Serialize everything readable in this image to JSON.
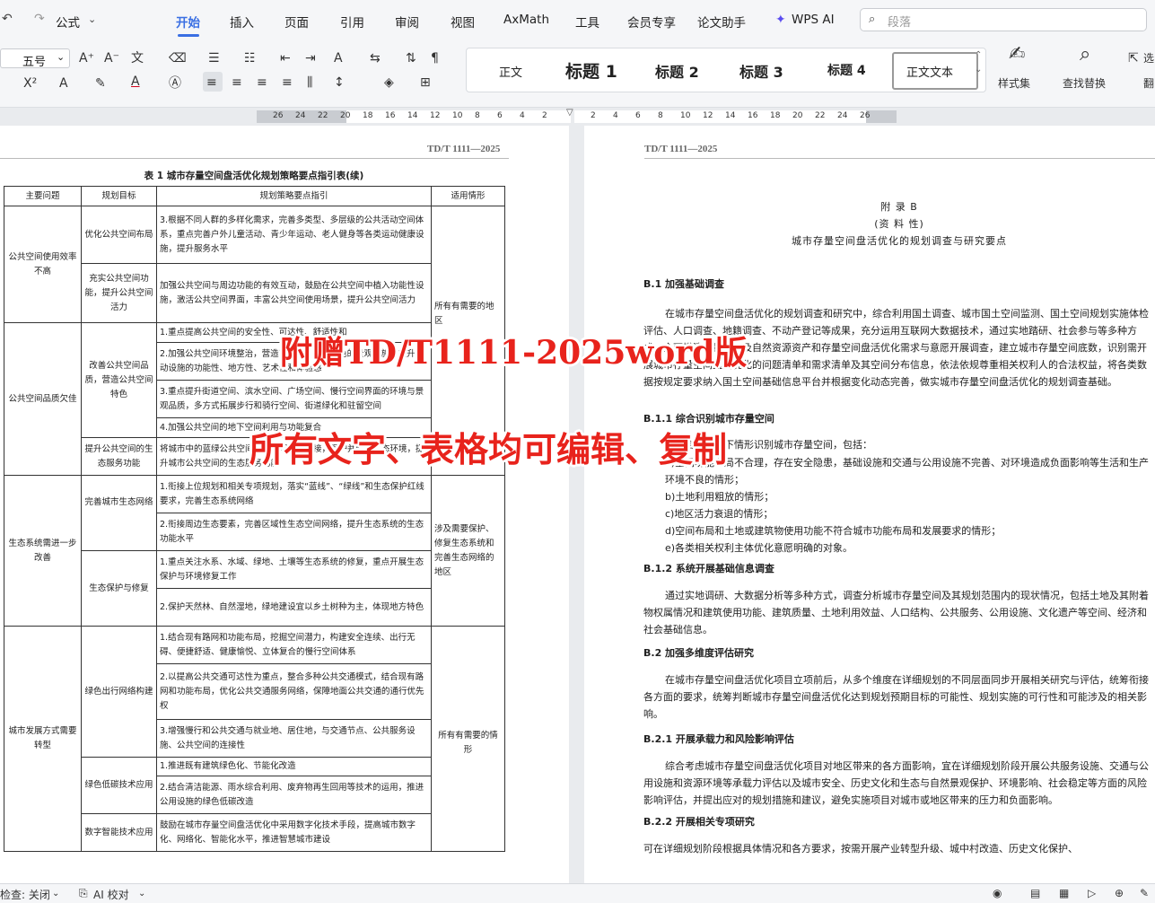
{
  "menubar": {
    "quick": "公式",
    "tabs": [
      "开始",
      "插入",
      "页面",
      "引用",
      "审阅",
      "视图",
      "AxMath",
      "工具",
      "会员专享",
      "论文助手",
      "WPS AI"
    ],
    "active_tab": "开始",
    "search_placeholder": "段落"
  },
  "ribbon": {
    "font_size": "五号",
    "styles": [
      "正文",
      "标题 1",
      "标题 2",
      "标题 3",
      "标题 4",
      "正文文本"
    ],
    "styles_set": "样式集",
    "find_replace": "查找替换",
    "select": "选",
    "other": "翻"
  },
  "ruler": {
    "left": [
      "26",
      "24",
      "22",
      "20",
      "18",
      "16",
      "14",
      "12",
      "10",
      "8",
      "6",
      "4",
      "2"
    ],
    "right": [
      "2",
      "4",
      "6",
      "8",
      "10",
      "12",
      "14",
      "16",
      "18",
      "20",
      "22",
      "24",
      "26"
    ]
  },
  "left_page": {
    "header": "TD/T 1111—2025",
    "caption": "表 1  城市存量空间盘活优化规划策略要点指引表(续)",
    "columns": [
      "主要问题",
      "规划目标",
      "规划策略要点指引",
      "适用情形"
    ],
    "rows": {
      "p1": "公共空间使用效率不高",
      "g1": "优化公共空间布局",
      "s1": "3.根据不同人群的多样化需求，完善多类型、多层级的公共活动空间体系，重点完善户外儿童活动、青少年运动、老人健身等各类运动健康设施，提升服务水平",
      "g2": "充实公共空间功能，提升公共空间活力",
      "s2": "加强公共空间与周边功能的有效互动，鼓励在公共空间中植入功能性设施，激活公共空间界面，丰富公共空间使用场景，提升公共空间活力",
      "a1": "所有有需要的地区",
      "p2": "公共空间品质欠佳",
      "g3": "改善公共空间品质，营造公共空间特色",
      "s3": "1.重点提高公共空间的安全性、可达性、舒适性和",
      "s4": "2.加强公共空间环境整治，营造高品质、具有特色的景观设施，提升活动设施的功能性、地方性、艺术性和体验感",
      "s5": "3.重点提升街道空间、滨水空间、广场空间、慢行空间界面的环境与景观品质，多方式拓展步行和骑行空间、街道绿化和驻留空间",
      "s6": "4.加强公共空间的地下空间利用与功能复合",
      "g4": "提升公共空间的生态服务功能",
      "s7": "将城市中的蓝绿公共空间与生态网络相连接，保护并修复生态环境，提升城市公共空间的生态服务功能",
      "p3": "生态系统需进一步改善",
      "g5": "完善城市生态网络",
      "s8": "1.衔接上位规划和相关专项规划，落实“蓝线”、“绿线”和生态保护红线要求，完善生态系统网络",
      "s9": "2.衔接周边生态要素，完善区域性生态空间网络，提升生态系统的生态功能水平",
      "a2": "涉及需要保护、修复生态系统和完善生态网络的地区",
      "g6": "生态保护与修复",
      "s10": "1.重点关注水系、水域、绿地、土壤等生态系统的修复，重点开展生态保护与环境修复工作",
      "s11": "2.保护天然林、自然湿地，绿地建设宜以乡土树种为主，体现地方特色",
      "p4": "城市发展方式需要转型",
      "g7": "绿色出行网络构建",
      "s12": "1.结合现有路网和功能布局，挖掘空间潜力，构建安全连续、出行无碍、便捷舒适、健康愉悦、立体复合的慢行空间体系",
      "s13": "2.以提高公共交通可达性为重点，整合多种公共交通模式，结合现有路网和功能布局，优化公共交通服务网络，保障地面公共交通的通行优先权",
      "s14": "3.增强慢行和公共交通与就业地、居住地，与交通节点、公共服务设施、公共空间的连接性",
      "a3": "所有有需要的情形",
      "g8": "绿色低碳技术应用",
      "s15": "1.推进既有建筑绿色化、节能化改造",
      "s16": "2.结合清洁能源、雨水综合利用、废弃物再生回用等技术的运用，推进公用设施的绿色低碳改造",
      "g9": "数字智能技术应用",
      "s17": "鼓励在城市存量空间盘活优化中采用数字化技术手段，提高城市数字化、网络化、智能化水平，推进智慧城市建设"
    }
  },
  "right_page": {
    "header": "TD/T 1111—2025",
    "appendix": "附    录    B",
    "nature": "(资 料 性)",
    "title": "城市存量空间盘活优化的规划调查与研究要点",
    "b1": "B.1  加强基础调查",
    "b1_text": "在城市存量空间盘活优化的规划调查和研究中，综合利用国土调查、城市国土空间监测、国土空间规划实施体检评估、人口调查、地籍调查、不动产登记等成果，充分运用互联网大数据技术，通过实地踏研、社会参与等多种方式，全面摸清存量空间及自然资源资产和存量空间盘活优化需求与意愿开展调查，建立城市存量空间底数，识别需开展城市存量空间盘活优化的问题清单和需求清单及其空间分布信息，依法依规尊重相关权利人的合法权益，将各类数据按规定要求纳入国土空间基础信息平台并根据变化动态完善，做实城市存量空间盘活优化的规划调查基础。",
    "b11": "B.1.1  综合识别城市存量空间",
    "b11_text": "宜综合考虑以下情形识别城市存量空间，包括：",
    "b11_items": [
      "a)空间功能布局不合理，存在安全隐患，基础设施和交通与公用设施不完善、对环境造成负面影响等生活和生产环境不良的情形；",
      "b)土地利用粗放的情形；",
      "c)地区活力衰退的情形；",
      "d)空间布局和土地或建筑物使用功能不符合城市功能布局和发展要求的情形；",
      "e)各类相关权利主体优化意愿明确的对象。"
    ],
    "b12": "B.1.2  系统开展基础信息调查",
    "b12_text": "通过实地调研、大数据分析等多种方式，调查分析城市存量空间及其规划范围内的现状情况，包括土地及其附着物权属情况和建筑使用功能、建筑质量、土地利用效益、人口结构、公共服务、公用设施、文化遗产等空间、经济和社会基础信息。",
    "b2": "B.2  加强多维度评估研究",
    "b2_text": "在城市存量空间盘活优化项目立项前后，从多个维度在详细规划的不同层面同步开展相关研究与评估，统筹衔接各方面的要求，统筹判断城市存量空间盘活优化达到规划预期目标的可能性、规划实施的可行性和可能涉及的相关影响。",
    "b21": "B.2.1  开展承载力和风险影响评估",
    "b21_text": "综合考虑城市存量空间盘活优化项目对地区带来的各方面影响，宜在详细规划阶段开展公共服务设施、交通与公用设施和资源环境等承载力评估以及城市安全、历史文化和生态与自然景观保护、环境影响、社会稳定等方面的风险影响评估，并提出应对的规划措施和建议，避免实施项目对城市或地区带来的压力和负面影响。",
    "b22": "B.2.2  开展相关专项研究",
    "b22_text": "可在详细规划阶段根据具体情况和各方要求，按需开展产业转型升级、城中村改造、历史文化保护、"
  },
  "overlay": {
    "line1": "附赠TD/T1111-2025word版",
    "line2": "所有文字、表格均可编辑、复制"
  },
  "statusbar": {
    "check": "检查: 关闭",
    "ai": "AI 校对"
  },
  "colors": {
    "accent": "#3a6fe3",
    "overlay_red": "#e8231c"
  }
}
